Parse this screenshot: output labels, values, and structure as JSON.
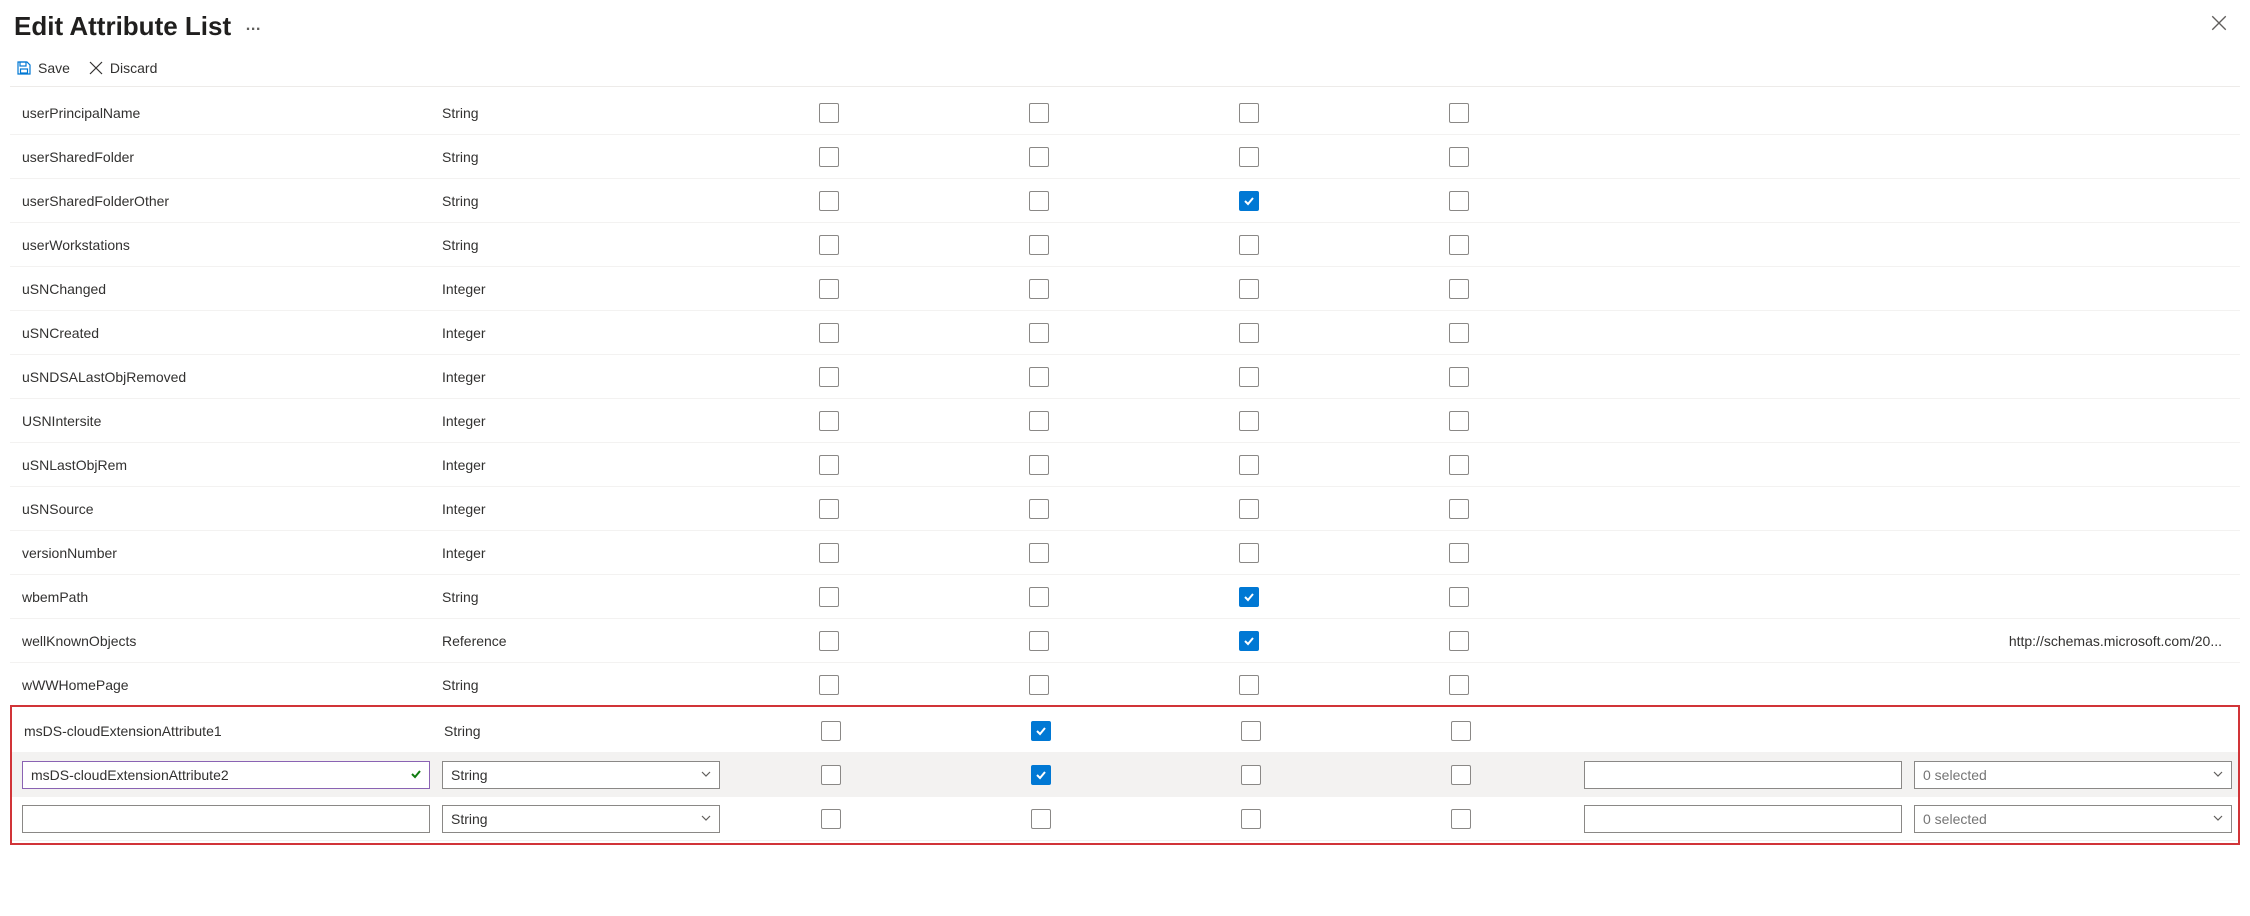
{
  "header": {
    "title": "Edit Attribute List",
    "more": "…"
  },
  "toolbar": {
    "save_label": "Save",
    "discard_label": "Discard"
  },
  "rows": [
    {
      "name": "userPrincipalName",
      "type": "String",
      "c1": false,
      "c2": false,
      "c3": false,
      "c4": false,
      "link": ""
    },
    {
      "name": "userSharedFolder",
      "type": "String",
      "c1": false,
      "c2": false,
      "c3": false,
      "c4": false,
      "link": ""
    },
    {
      "name": "userSharedFolderOther",
      "type": "String",
      "c1": false,
      "c2": false,
      "c3": true,
      "c4": false,
      "link": ""
    },
    {
      "name": "userWorkstations",
      "type": "String",
      "c1": false,
      "c2": false,
      "c3": false,
      "c4": false,
      "link": ""
    },
    {
      "name": "uSNChanged",
      "type": "Integer",
      "c1": false,
      "c2": false,
      "c3": false,
      "c4": false,
      "link": ""
    },
    {
      "name": "uSNCreated",
      "type": "Integer",
      "c1": false,
      "c2": false,
      "c3": false,
      "c4": false,
      "link": ""
    },
    {
      "name": "uSNDSALastObjRemoved",
      "type": "Integer",
      "c1": false,
      "c2": false,
      "c3": false,
      "c4": false,
      "link": ""
    },
    {
      "name": "USNIntersite",
      "type": "Integer",
      "c1": false,
      "c2": false,
      "c3": false,
      "c4": false,
      "link": ""
    },
    {
      "name": "uSNLastObjRem",
      "type": "Integer",
      "c1": false,
      "c2": false,
      "c3": false,
      "c4": false,
      "link": ""
    },
    {
      "name": "uSNSource",
      "type": "Integer",
      "c1": false,
      "c2": false,
      "c3": false,
      "c4": false,
      "link": ""
    },
    {
      "name": "versionNumber",
      "type": "Integer",
      "c1": false,
      "c2": false,
      "c3": false,
      "c4": false,
      "link": ""
    },
    {
      "name": "wbemPath",
      "type": "String",
      "c1": false,
      "c2": false,
      "c3": true,
      "c4": false,
      "link": ""
    },
    {
      "name": "wellKnownObjects",
      "type": "Reference",
      "c1": false,
      "c2": false,
      "c3": true,
      "c4": false,
      "link": "http://schemas.microsoft.com/20..."
    },
    {
      "name": "wWWHomePage",
      "type": "String",
      "c1": false,
      "c2": false,
      "c3": false,
      "c4": false,
      "link": ""
    }
  ],
  "highlight": {
    "row1": {
      "name": "msDS-cloudExtensionAttribute1",
      "type": "String",
      "c1": false,
      "c2": true,
      "c3": false,
      "c4": false
    },
    "row2": {
      "name_value": "msDS-cloudExtensionAttribute2",
      "type_value": "String",
      "c1": false,
      "c2": true,
      "c3": false,
      "c4": false,
      "dropdown_placeholder": "0 selected"
    },
    "row3": {
      "name_value": "",
      "type_value": "String",
      "c1": false,
      "c2": false,
      "c3": false,
      "c4": false,
      "dropdown_placeholder": "0 selected"
    }
  }
}
